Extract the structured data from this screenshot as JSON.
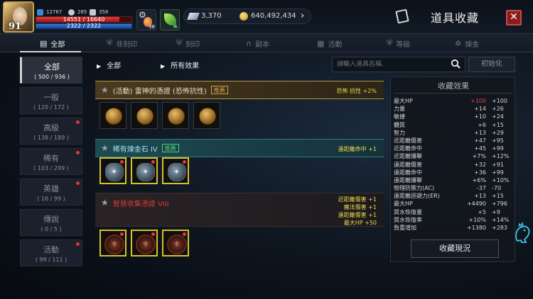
{
  "player": {
    "level": "91",
    "stat_a": "12767",
    "stat_b": "285",
    "stat_c": "358",
    "hp_text": "14551 / 16640",
    "hp_ratio": 0.874,
    "mp_text": "2322 / 2322",
    "mp_ratio": 1.0
  },
  "quick_items": {
    "potion_count": "38",
    "leaf_count": "∞"
  },
  "currency": {
    "gems": "3,370",
    "gold": "640,492,434"
  },
  "header": {
    "title": "道具收藏"
  },
  "tabs": [
    {
      "label": "全部",
      "icon": "book-icon",
      "active": true
    },
    {
      "label": "非刻印",
      "icon": "shield-icon",
      "active": false
    },
    {
      "label": "刻印",
      "icon": "shield-icon",
      "active": false
    },
    {
      "label": "副本",
      "icon": "helmet-icon",
      "active": false
    },
    {
      "label": "活動",
      "icon": "gift-icon",
      "active": false
    },
    {
      "label": "等級",
      "icon": "shield-icon",
      "active": false
    },
    {
      "label": "煉金",
      "icon": "gear-icon",
      "active": false
    }
  ],
  "grades": [
    {
      "name": "全部",
      "count": "( 500 / 936 )",
      "active": true,
      "dot": false
    },
    {
      "name": "一般",
      "count": "( 120 / 172 )",
      "active": false,
      "dot": false
    },
    {
      "name": "高級",
      "count": "( 138 / 189 )",
      "active": false,
      "dot": true
    },
    {
      "name": "稀有",
      "count": "( 103 / 299 )",
      "active": false,
      "dot": true
    },
    {
      "name": "英雄",
      "count": "( 16 / 99 )",
      "active": false,
      "dot": true
    },
    {
      "name": "傳說",
      "count": "( 0 / 5 )",
      "active": false,
      "dot": false
    },
    {
      "name": "活動",
      "count": "( 99 / 111 )",
      "active": false,
      "dot": true
    }
  ],
  "filters": {
    "grade_filter": "全部",
    "effect_filter": "所有效果"
  },
  "search": {
    "placeholder": "請輸入道具名稱."
  },
  "reset_label": "初始化",
  "groups": [
    {
      "title": "(活動) 雷神的憑證 (恐怖抗性)",
      "tag": "推薦",
      "effects": [
        "恐怖 抗性 +2%"
      ],
      "items": [
        "coin",
        "coin",
        "coin",
        "coin"
      ],
      "theme": "gold"
    },
    {
      "title": "稀有煉金石 IV",
      "tag": "推薦",
      "effects": [
        "遠距離命中 +1"
      ],
      "items": [
        "stone",
        "stone",
        "stone"
      ],
      "theme": "teal"
    },
    {
      "title": "智慧收集憑證 VIII",
      "tag": "",
      "effects": [
        "近距離傷害 +1",
        "魔法傷害 +1",
        "遠距離傷害 +1",
        "最大HP +50"
      ],
      "items": [
        "crest",
        "crest",
        "crest"
      ],
      "theme": "dark"
    }
  ],
  "effects_panel": {
    "title": "收藏效果",
    "rows": [
      {
        "name": "最大HP",
        "v1": "+100",
        "v2": "+100",
        "v1_color": "#e04848"
      },
      {
        "name": "力量",
        "v1": "+14",
        "v2": "+26"
      },
      {
        "name": "敏捷",
        "v1": "+10",
        "v2": "+24"
      },
      {
        "name": "體質",
        "v1": "+6",
        "v2": "+15"
      },
      {
        "name": "智力",
        "v1": "+13",
        "v2": "+29"
      },
      {
        "name": "近距離傷害",
        "v1": "+47",
        "v2": "+95"
      },
      {
        "name": "近距離命中",
        "v1": "+45",
        "v2": "+99"
      },
      {
        "name": "近距離爆擊",
        "v1": "+7%",
        "v2": "+12%"
      },
      {
        "name": "遠距離傷害",
        "v1": "+32",
        "v2": "+91"
      },
      {
        "name": "遠距離命中",
        "v1": "+36",
        "v2": "+99"
      },
      {
        "name": "遠距離爆擊",
        "v1": "+6%",
        "v2": "+10%"
      },
      {
        "name": "物理防禦力(AC)",
        "v1": "-37",
        "v2": "-70"
      },
      {
        "name": "遠距離迴避力(ER)",
        "v1": "+13",
        "v2": "+15"
      },
      {
        "name": "最大HP",
        "v1": "+4490",
        "v2": "+796"
      },
      {
        "name": "質水恢復量",
        "v1": "+5",
        "v2": "+9"
      },
      {
        "name": "質水恢復率",
        "v1": "+10%",
        "v2": "+14%"
      },
      {
        "name": "負重增加",
        "v1": "+1380",
        "v2": "+283"
      }
    ],
    "button_label": "收藏現況"
  }
}
